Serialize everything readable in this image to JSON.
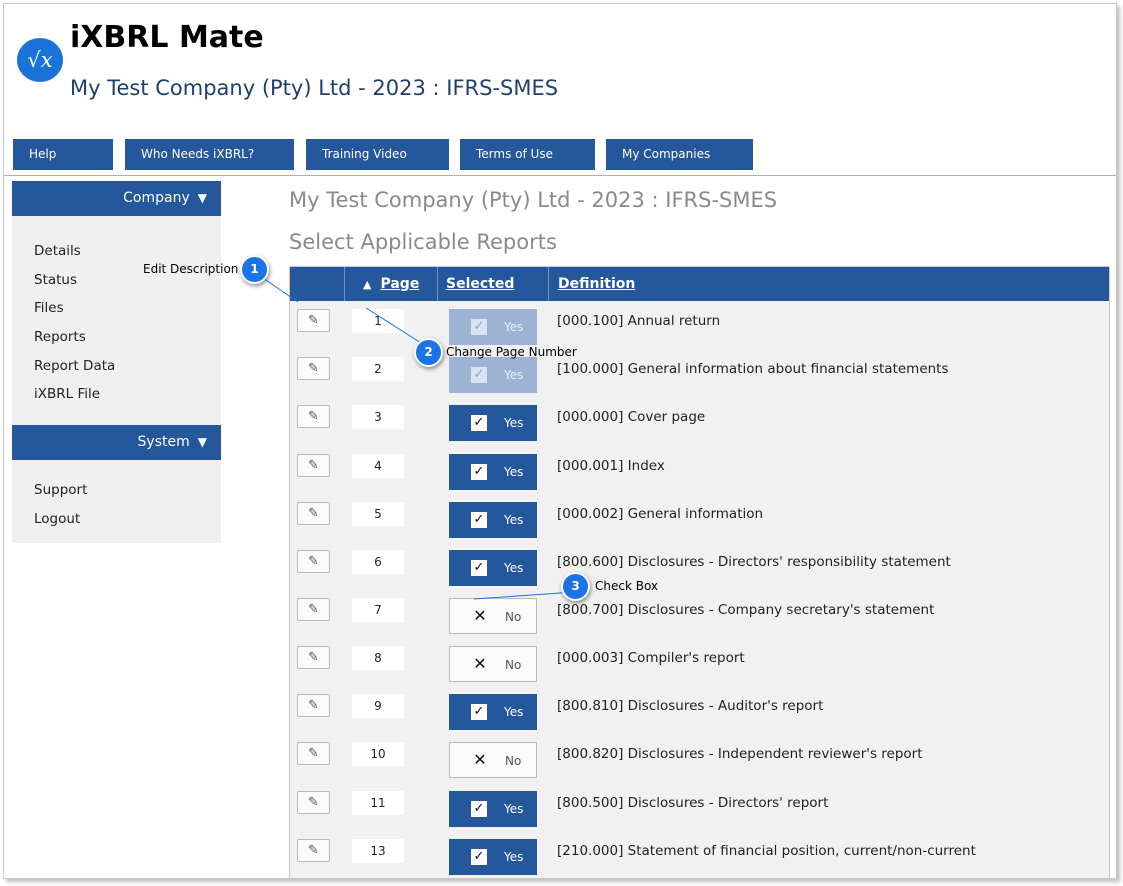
{
  "app": {
    "logo_glyph": "√x",
    "title": "iXBRL Mate",
    "subtitle": "My Test Company (Pty) Ltd - 2023 : IFRS-SMES"
  },
  "nav": [
    {
      "label": "Help"
    },
    {
      "label": "Who Needs iXBRL?"
    },
    {
      "label": "Training Video"
    },
    {
      "label": "Terms of Use"
    },
    {
      "label": "My Companies"
    }
  ],
  "sidebar": {
    "company_header": "Company",
    "company_items": [
      "Details",
      "Status",
      "Files",
      "Reports",
      "Report Data",
      "iXBRL File"
    ],
    "system_header": "System",
    "system_items": [
      "Support",
      "Logout"
    ],
    "toggle_icon": "triangle-down-icon"
  },
  "main": {
    "heading": "My Test Company (Pty) Ltd - 2023 : IFRS-SMES",
    "subheading": "Select Applicable Reports"
  },
  "table": {
    "headers": {
      "page": "Page",
      "selected": "Selected",
      "definition": "Definition"
    },
    "sort_icon": "triangle-up-icon",
    "rows": [
      {
        "page": "1",
        "selected": "Yes",
        "checked": true,
        "disabled": true,
        "definition": "[000.100] Annual return"
      },
      {
        "page": "2",
        "selected": "Yes",
        "checked": true,
        "disabled": true,
        "definition": "[100.000] General information about financial statements"
      },
      {
        "page": "3",
        "selected": "Yes",
        "checked": true,
        "disabled": false,
        "definition": "[000.000] Cover page"
      },
      {
        "page": "4",
        "selected": "Yes",
        "checked": true,
        "disabled": false,
        "definition": "[000.001] Index"
      },
      {
        "page": "5",
        "selected": "Yes",
        "checked": true,
        "disabled": false,
        "definition": "[000.002] General information"
      },
      {
        "page": "6",
        "selected": "Yes",
        "checked": true,
        "disabled": false,
        "definition": "[800.600] Disclosures - Directors' responsibility statement"
      },
      {
        "page": "7",
        "selected": "No",
        "checked": false,
        "disabled": false,
        "definition": "[800.700] Disclosures - Company secretary's statement"
      },
      {
        "page": "8",
        "selected": "No",
        "checked": false,
        "disabled": false,
        "definition": "[000.003] Compiler's report"
      },
      {
        "page": "9",
        "selected": "Yes",
        "checked": true,
        "disabled": false,
        "definition": "[800.810] Disclosures - Auditor's report"
      },
      {
        "page": "10",
        "selected": "No",
        "checked": false,
        "disabled": false,
        "definition": "[800.820] Disclosures - Independent reviewer's report"
      },
      {
        "page": "11",
        "selected": "Yes",
        "checked": true,
        "disabled": false,
        "definition": "[800.500] Disclosures - Directors' report"
      },
      {
        "page": "13",
        "selected": "Yes",
        "checked": true,
        "disabled": false,
        "definition": "[210.000] Statement of financial position, current/non-current"
      }
    ]
  },
  "callouts": [
    {
      "number": "1",
      "label": "Edit Description"
    },
    {
      "number": "2",
      "label": "Change Page Number"
    },
    {
      "number": "3",
      "label": "Check Box"
    }
  ],
  "colors": {
    "primary": "#24579b",
    "callout": "#1a73e8",
    "heading_gray": "#8a8a8a",
    "subtitle": "#1f3f6e"
  }
}
